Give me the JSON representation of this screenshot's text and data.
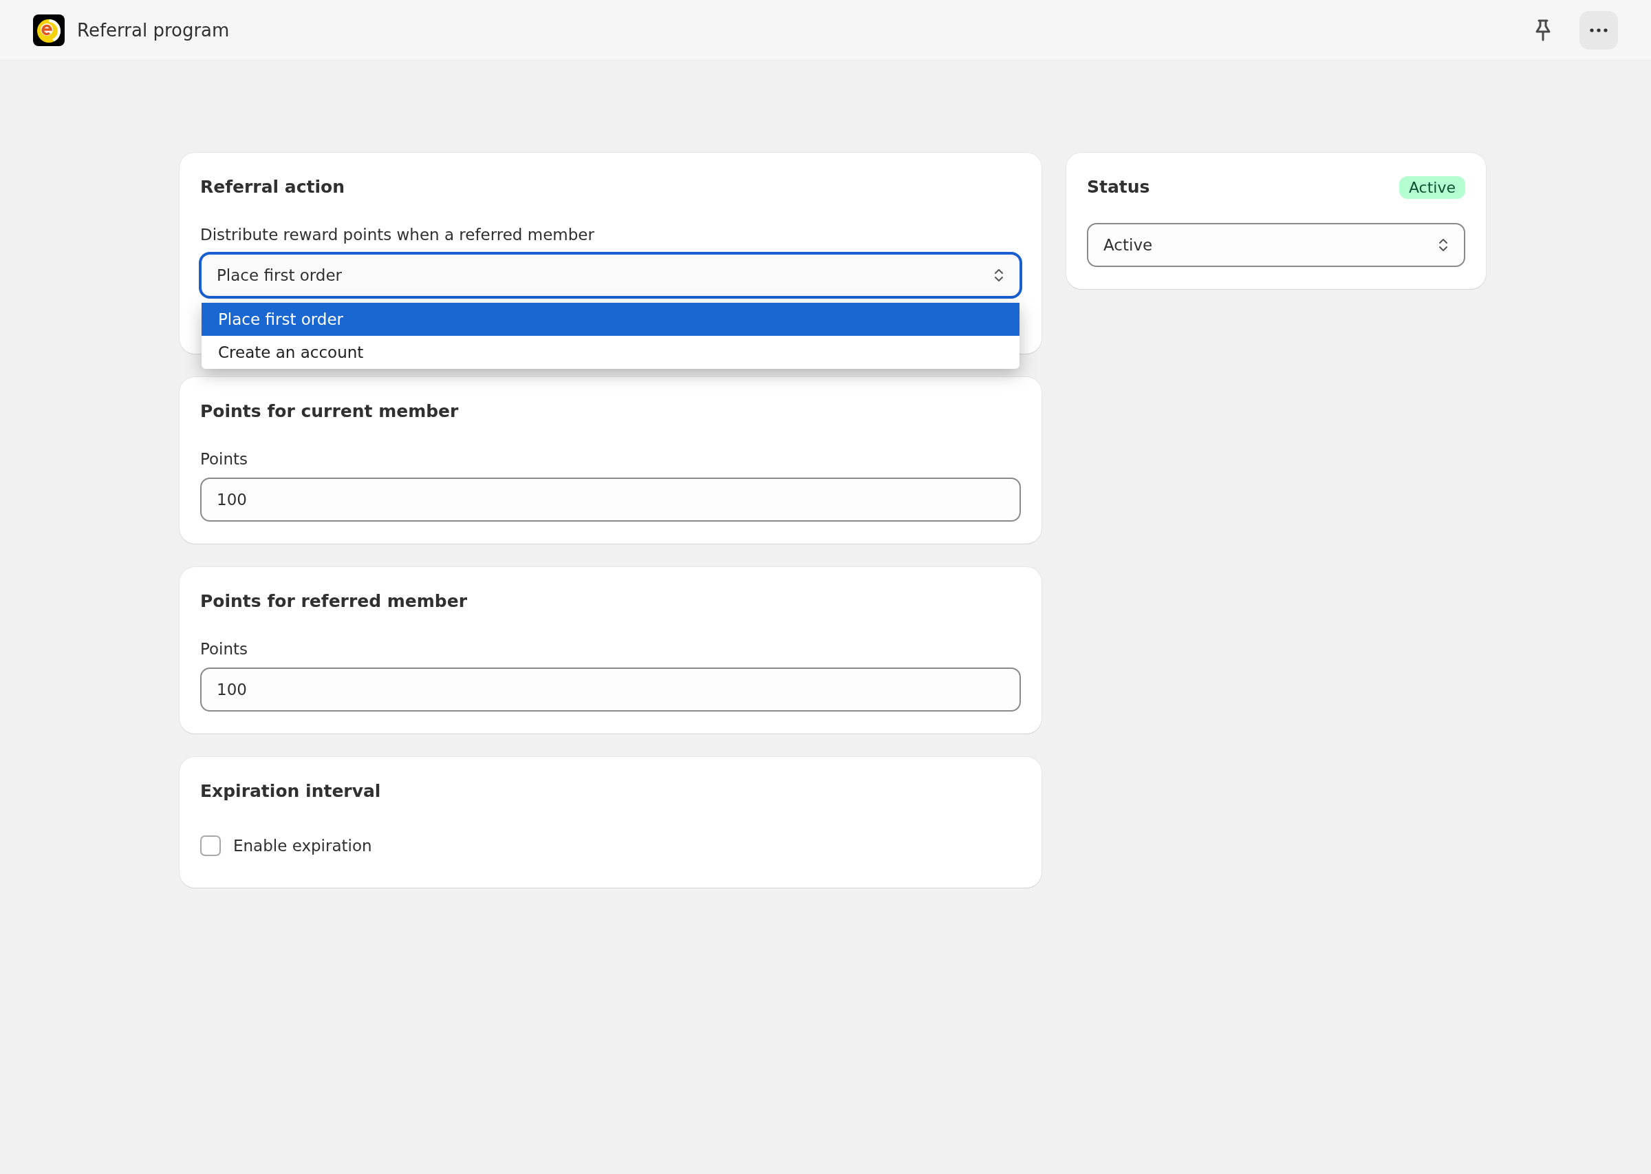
{
  "header": {
    "title": "Referral program"
  },
  "cards": [
    {
      "kind": "select",
      "title": "Referral action",
      "label": "Distribute reward points when a referred member",
      "value": "Place first order",
      "open": true,
      "options": [
        {
          "label": "Place first order",
          "selected": true
        },
        {
          "label": "Create an account",
          "selected": false
        }
      ]
    },
    {
      "kind": "number",
      "title": "Points for current member",
      "label": "Points",
      "value": "100"
    },
    {
      "kind": "number",
      "title": "Points for referred member",
      "label": "Points",
      "value": "100"
    },
    {
      "kind": "checkbox",
      "title": "Expiration interval",
      "label": "Enable expiration",
      "checked": false
    }
  ],
  "status": {
    "title": "Status",
    "badge": "Active",
    "value": "Active"
  }
}
